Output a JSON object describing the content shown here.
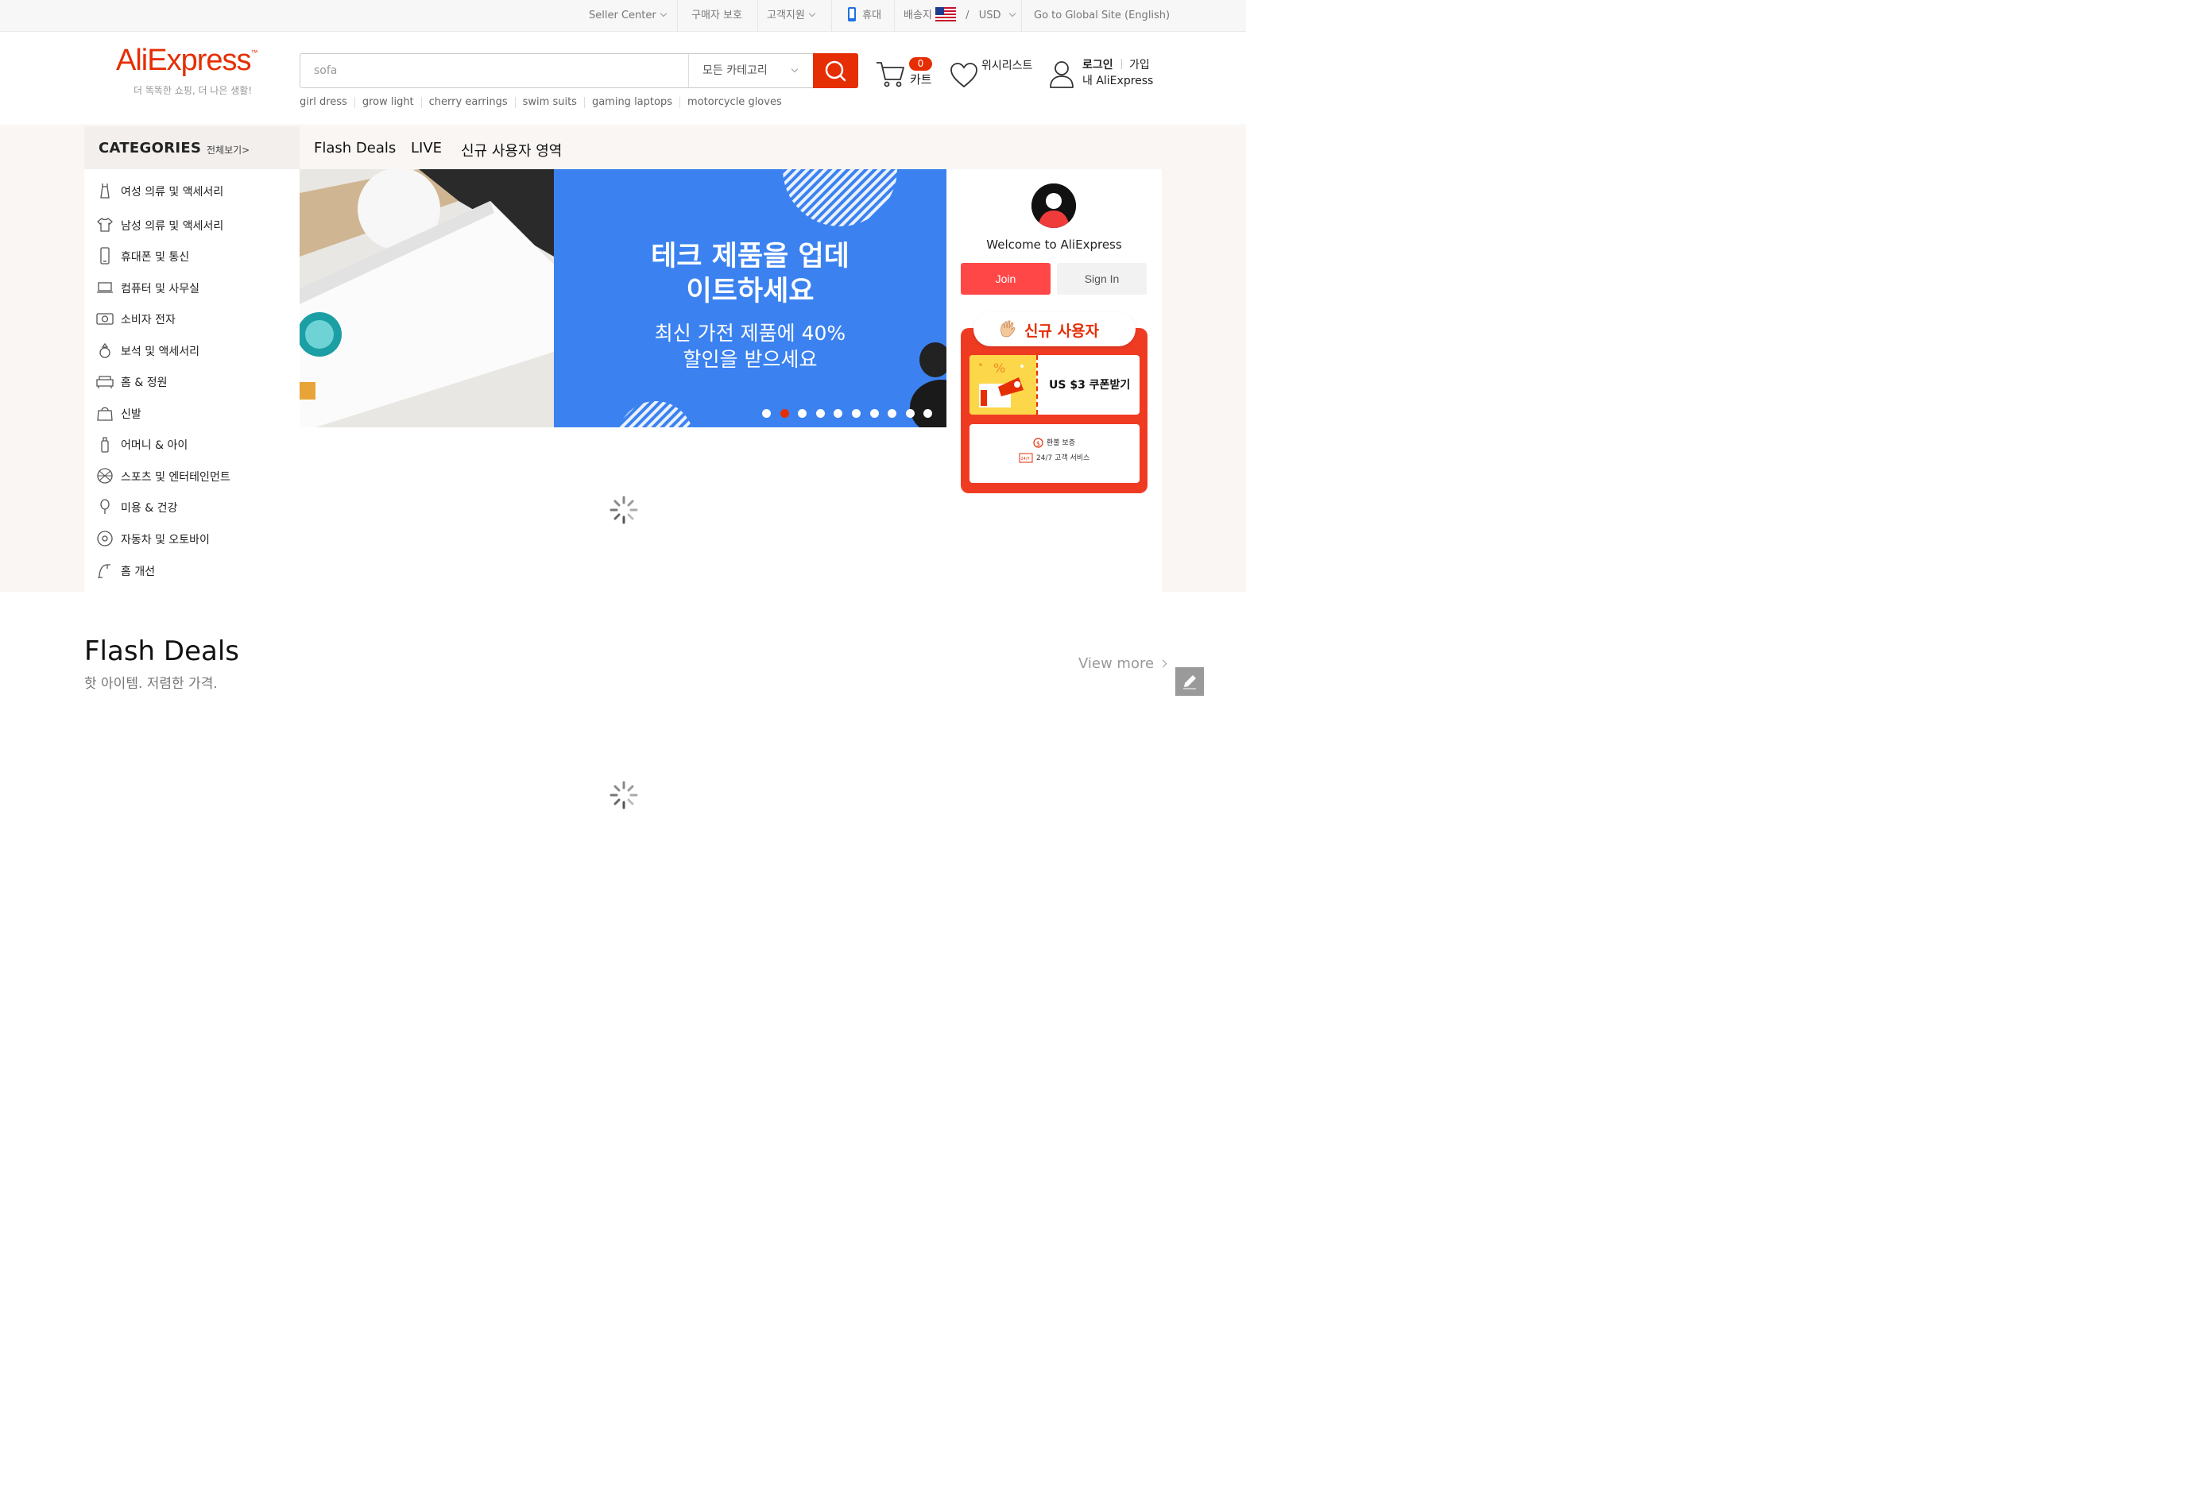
{
  "topbar": {
    "seller_center": "Seller Center",
    "buyer_protection": "구매자 보호",
    "help": "고객지원",
    "mobile": "휴대",
    "ship_to": "배송지",
    "currency_sep": "/",
    "currency": "USD",
    "global_site": "Go to Global Site (English)"
  },
  "header": {
    "logo": "AliExpress",
    "logo_tm": "™",
    "slogan": "더 똑똑한 쇼핑, 더 나은 생활!",
    "search_value": "sofa",
    "search_category": "모든 카테고리",
    "hot_words": [
      "girl dress",
      "grow light",
      "cherry earrings",
      "swim suits",
      "gaming laptops",
      "motorcycle gloves"
    ],
    "cart_count": "0",
    "cart_label": "카트",
    "wishlist_label": "위시리스트",
    "login": "로그인",
    "join": "가입",
    "my_account": "내 AliExpress"
  },
  "categories": {
    "title": "CATEGORIES",
    "view_all": "전체보기>",
    "items": [
      {
        "label": "여성 의류 및 액세서리",
        "icon": "dress-icon"
      },
      {
        "label": "남성 의류 및 액세서리",
        "icon": "shirt-icon"
      },
      {
        "label": "휴대폰 및 통신",
        "icon": "phone-icon"
      },
      {
        "label": "컴퓨터 및 사무실",
        "icon": "laptop-icon"
      },
      {
        "label": "소비자 전자",
        "icon": "camera-icon"
      },
      {
        "label": "보석 및 액세서리",
        "icon": "ring-icon"
      },
      {
        "label": "홈 & 정원",
        "icon": "sofa-icon"
      },
      {
        "label": "신발",
        "icon": "bag-icon"
      },
      {
        "label": "어머니 & 아이",
        "icon": "bottle-icon"
      },
      {
        "label": "스포츠 및 엔터테인먼트",
        "icon": "ball-icon"
      },
      {
        "label": "미용 & 건강",
        "icon": "mirror-icon"
      },
      {
        "label": "자동차 및 오토바이",
        "icon": "wheel-icon"
      },
      {
        "label": "홈 개선",
        "icon": "faucet-icon"
      }
    ]
  },
  "nav_tabs": [
    "Flash Deals",
    "LIVE",
    "신규 사용자 영역"
  ],
  "banner": {
    "line1": "테크 제품을 업데",
    "line2": "이트하세요",
    "line3": "최신 가전 제품에 40%",
    "line4": "할인을 받으세요",
    "dots": 10,
    "active_dot": 1
  },
  "user_card": {
    "welcome": "Welcome to AliExpress",
    "join": "Join",
    "sign_in": "Sign In",
    "new_user_title": "신규 사용자",
    "coupon": "US $3 쿠폰받기",
    "refund": "환불 보증",
    "service": "24/7 고객 서비스",
    "service_badge": "24/7"
  },
  "flash_deals": {
    "title": "Flash Deals",
    "subtitle": "핫 아이템. 저렴한 가격.",
    "view_more": "View more"
  },
  "colors": {
    "brand": "#e62e04",
    "join_button": "#ff4747",
    "banner_blue": "#3b82f0"
  }
}
